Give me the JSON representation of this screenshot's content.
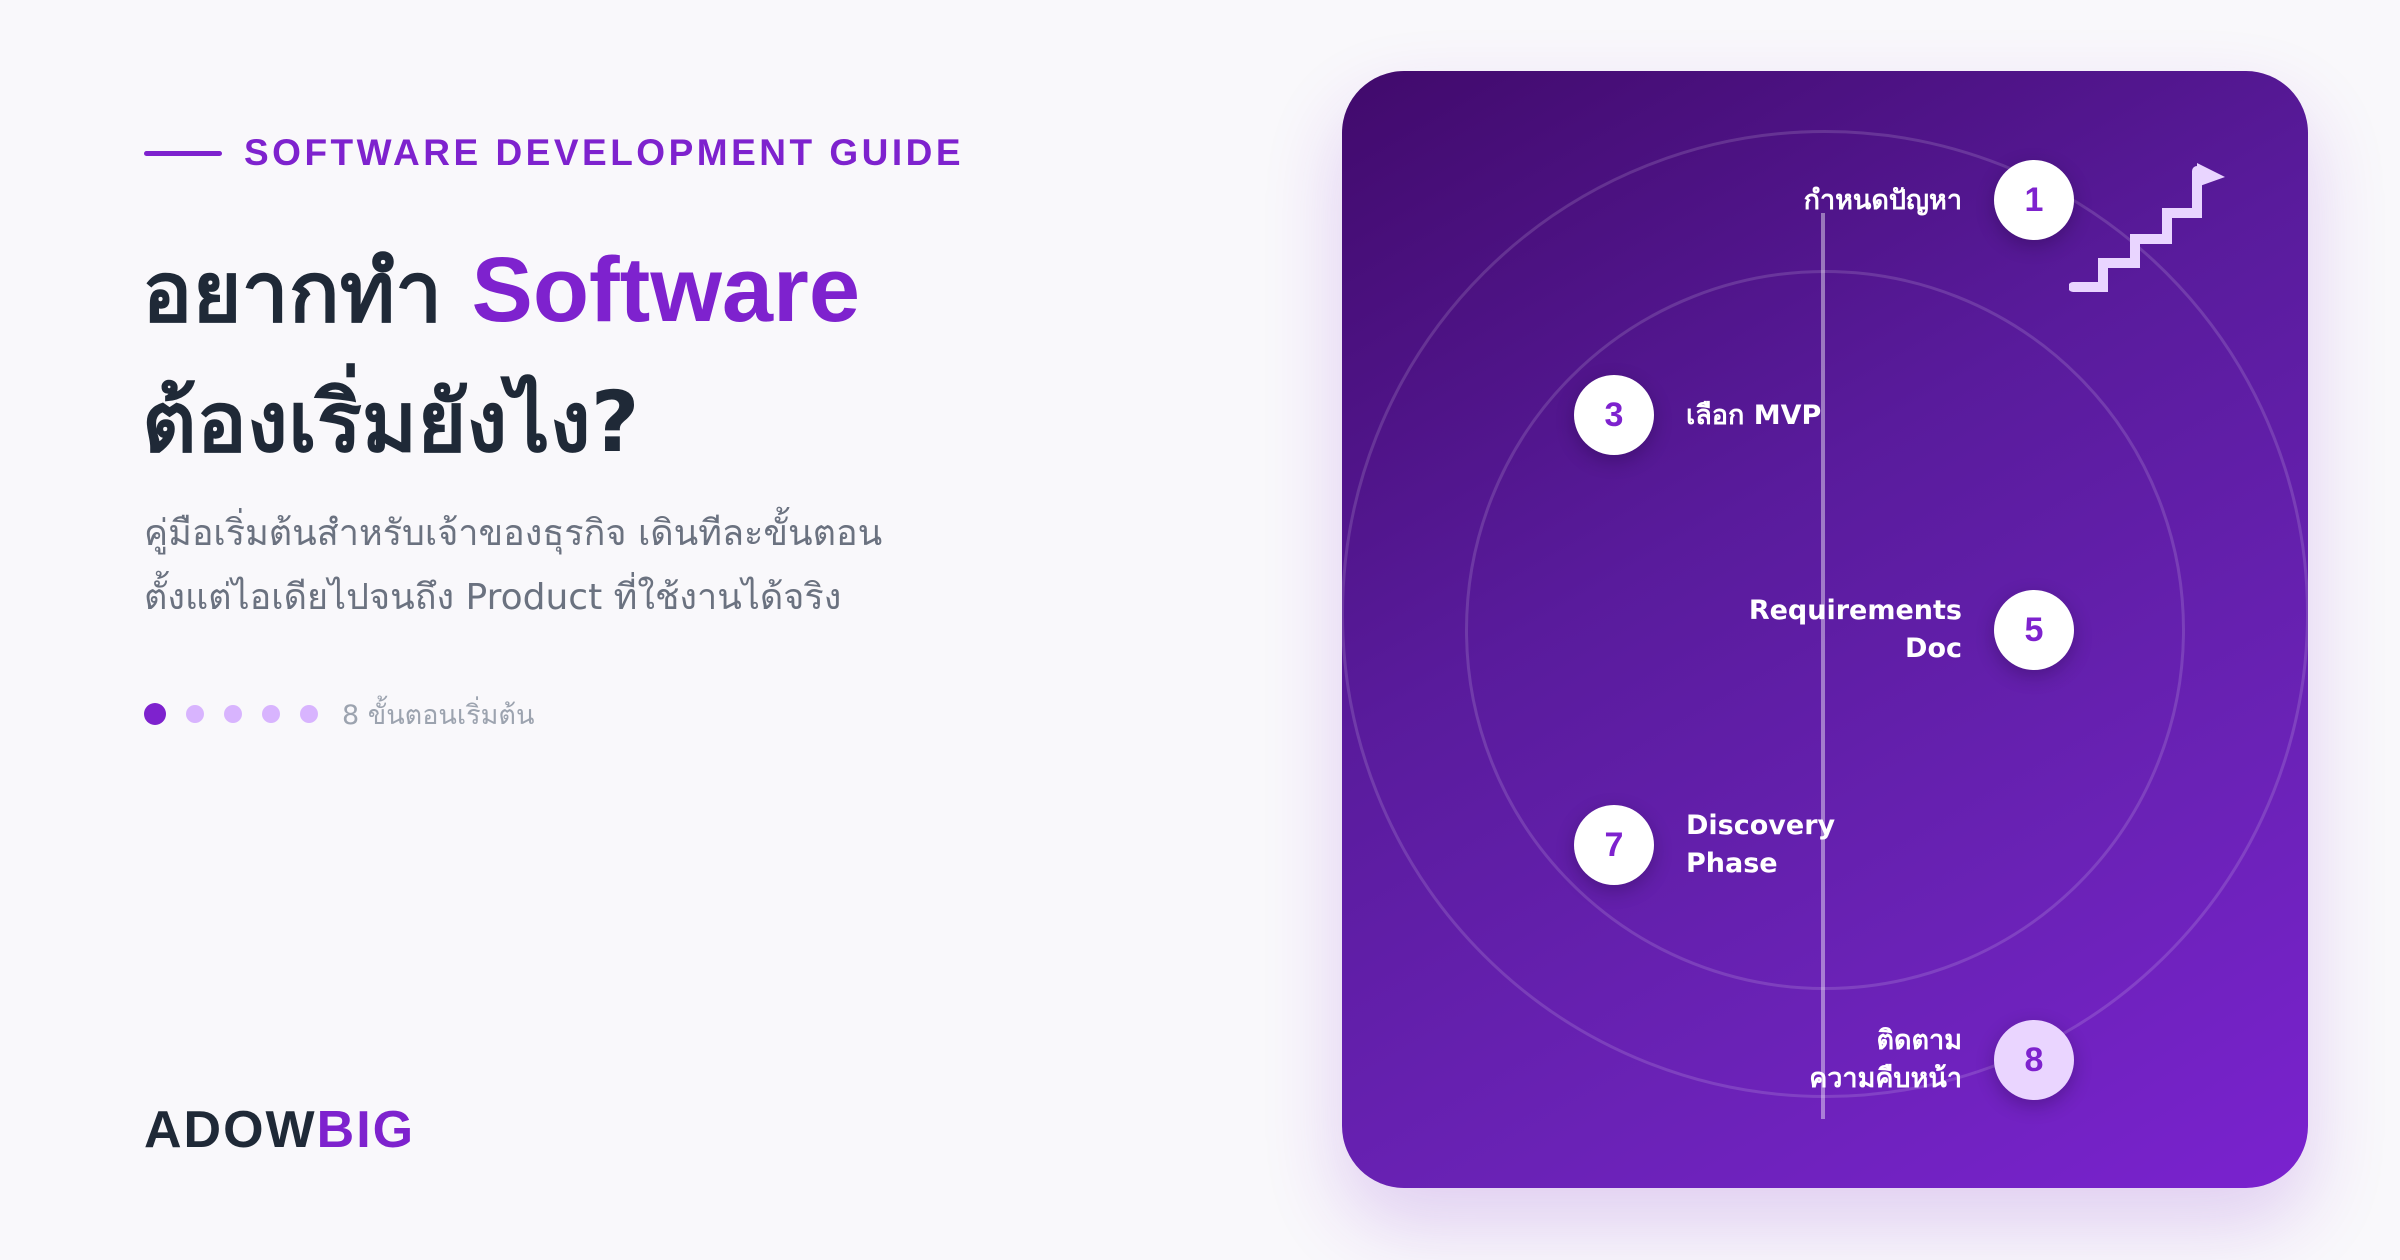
{
  "eyebrow": "SOFTWARE DEVELOPMENT GUIDE",
  "headline": {
    "line1_prefix": "อยากทำ ",
    "line1_accent": "Software",
    "line2": "ต้องเริ่มยังไง?"
  },
  "subtitle": {
    "line1": "คู่มือเริ่มต้นสำหรับเจ้าของธุรกิจ เดินทีละขั้นตอน",
    "line2": "ตั้งแต่ไอเดียไปจนถึง Product ที่ใช้งานได้จริง"
  },
  "progress": {
    "dot_count": 5,
    "active_index": 0,
    "caption": "8 ขั้นตอนเริ่มต้น"
  },
  "logo": {
    "part1": "ADOW",
    "part2": "BIG"
  },
  "timeline": {
    "steps": [
      {
        "number": "1",
        "label": "กำหนดปัญหา"
      },
      {
        "number": "3",
        "label": "เลือก MVP"
      },
      {
        "number": "5",
        "label": "Requirements\nDoc"
      },
      {
        "number": "7",
        "label": "Discovery\nPhase"
      },
      {
        "number": "8",
        "label": "ติดตาม\nความคืบหน้า"
      }
    ]
  },
  "icons": {
    "card_corner": "stairs-flag-icon"
  },
  "colors": {
    "accent": "#7e22ce",
    "text_dark": "#1f2937",
    "text_muted": "#6b7280",
    "dot_inactive": "#d8b4fe",
    "card_dark": "#410a6c",
    "card_light": "#7a22cf",
    "badge_highlight": "#ead5ff"
  }
}
